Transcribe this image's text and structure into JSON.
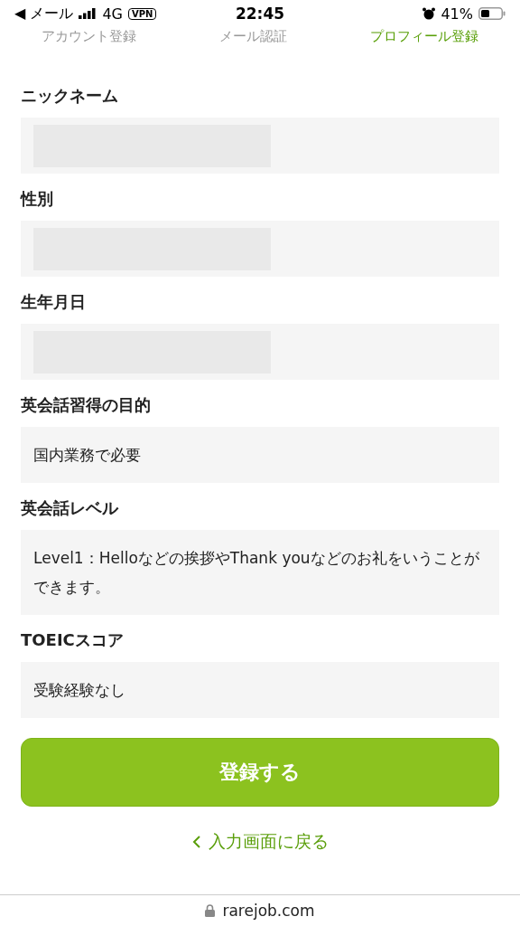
{
  "status_bar": {
    "back": "◀ メール",
    "network": "4G",
    "vpn": "VPN",
    "time": "22:45",
    "battery": "41%"
  },
  "steps": [
    {
      "label": "アカウント登録",
      "selected": false
    },
    {
      "label": "メール認証",
      "selected": false
    },
    {
      "label": "プロフィール登録",
      "selected": true
    }
  ],
  "fields": [
    {
      "label": "ニックネーム",
      "kind": "masked"
    },
    {
      "label": "性別",
      "kind": "masked"
    },
    {
      "label": "生年月日",
      "kind": "masked"
    },
    {
      "label": "英会話習得の目的",
      "kind": "text",
      "value": "国内業務で必要"
    },
    {
      "label": "英会話レベル",
      "kind": "text",
      "value": "Level1：Helloなどの挨拶やThank youなどのお礼をいうことができます。"
    },
    {
      "label": "TOEICスコア",
      "kind": "text",
      "value": "受験経験なし"
    }
  ],
  "submit": "登録する",
  "back_link": "入力画面に戻る",
  "url": "rarejob.com"
}
